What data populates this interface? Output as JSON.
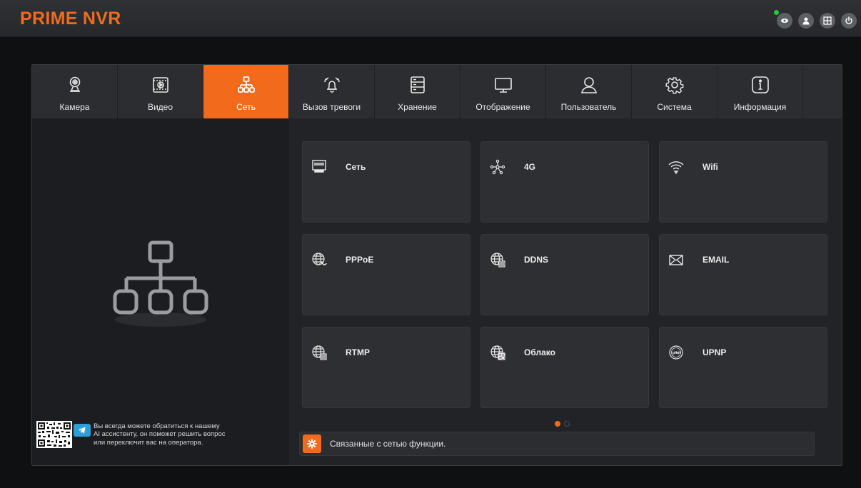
{
  "app": {
    "title": "PRIME NVR"
  },
  "top_icons": [
    {
      "name": "live-view-icon"
    },
    {
      "name": "user-icon"
    },
    {
      "name": "layout-icon"
    },
    {
      "name": "power-icon"
    }
  ],
  "tabs": [
    {
      "label": "Камера",
      "icon": "camera-icon"
    },
    {
      "label": "Видео",
      "icon": "video-icon"
    },
    {
      "label": "Сеть",
      "icon": "network-icon",
      "active": true
    },
    {
      "label": "Вызов тревоги",
      "icon": "alarm-icon"
    },
    {
      "label": "Хранение",
      "icon": "storage-icon"
    },
    {
      "label": "Отображение",
      "icon": "display-icon"
    },
    {
      "label": "Пользователь",
      "icon": "user-icon"
    },
    {
      "label": "Система",
      "icon": "system-gear-icon"
    },
    {
      "label": "Информация",
      "icon": "info-icon"
    }
  ],
  "cards": [
    {
      "label": "Сеть",
      "icon": "ethernet-icon"
    },
    {
      "label": "4G",
      "icon": "mobile-network-icon"
    },
    {
      "label": "Wifi",
      "icon": "wifi-icon"
    },
    {
      "label": "PPPoE",
      "icon": "pppoe-globe-icon"
    },
    {
      "label": "DDNS",
      "icon": "ddns-globe-icon"
    },
    {
      "label": "EMAIL",
      "icon": "email-icon"
    },
    {
      "label": "RTMP",
      "icon": "rtmp-globe-icon"
    },
    {
      "label": "Облако",
      "icon": "cloud-globe-icon"
    },
    {
      "label": "UPNP",
      "icon": "upnp-icon"
    }
  ],
  "pagination": {
    "current": 1,
    "total": 2
  },
  "assistant": {
    "line1": "Вы всегда можете обратиться к нашему",
    "line2": "AI ассистенту, он поможет решить вопрос",
    "line3": "или переключит вас на оператора."
  },
  "related": {
    "text": "Связанные с сетью функции."
  },
  "colors": {
    "accent": "#f26b1d",
    "panel": "#1c1d20",
    "card": "#2d2f33"
  }
}
